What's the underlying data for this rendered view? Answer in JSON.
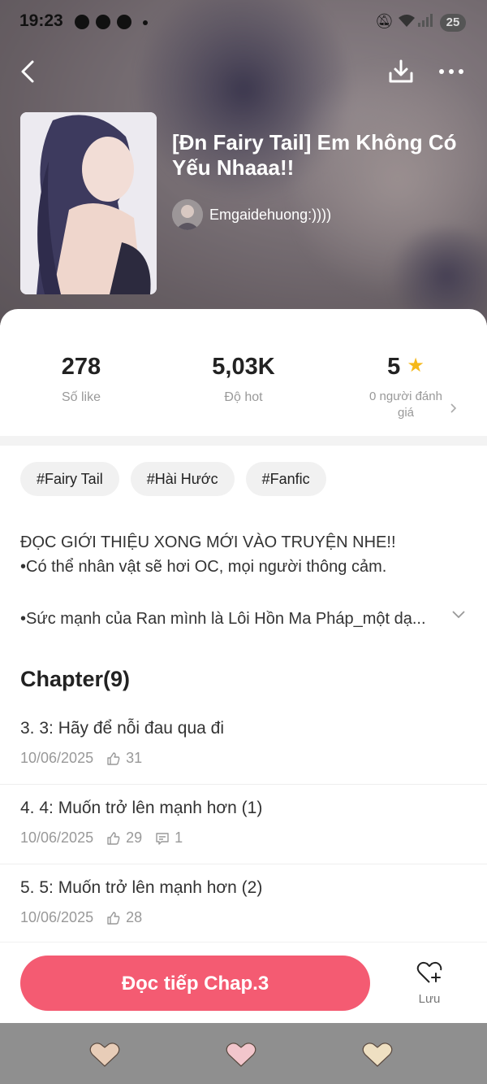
{
  "status_bar": {
    "time": "19:23",
    "battery": "25"
  },
  "colors": {
    "accent": "#f45b72",
    "star": "#f5b81a",
    "nav_bar": "#8f8f8f"
  },
  "story": {
    "title": "[Đn Fairy Tail] Em Không Có Yếu Nhaaa!!",
    "author": "Emgaidehuong:))))"
  },
  "stats": {
    "likes": {
      "value": "278",
      "label": "Số like"
    },
    "hot": {
      "value": "5,03K",
      "label": "Độ hot"
    },
    "rating": {
      "value": "5",
      "label_line1": "0 người đánh",
      "label_line2": "giá"
    }
  },
  "tags": [
    "#Fairy Tail",
    "#Hài Hước",
    "#Fanfic"
  ],
  "description": {
    "line1": "ĐỌC GIỚI THIỆU XONG MỚI VÀO TRUYỆN NHE!!",
    "line2": "•Có thể nhân vật sẽ hơi OC, mọi người thông cảm.",
    "line3": "•Sức mạnh của Ran mình là Lôi Hồn Ma Pháp_một dạ..."
  },
  "chapters": {
    "heading": "Chapter(9)",
    "items": [
      {
        "name": "3. 3: Hãy để nỗi đau qua đi",
        "date": "10/06/2025",
        "likes": "31",
        "comments": ""
      },
      {
        "name": "4. 4: Muốn trở lên mạnh hơn (1)",
        "date": "10/06/2025",
        "likes": "29",
        "comments": "1"
      },
      {
        "name": "5. 5: Muốn trở lên mạnh hơn (2)",
        "date": "10/06/2025",
        "likes": "28",
        "comments": ""
      }
    ]
  },
  "actions": {
    "read_label": "Đọc tiếp Chap.3",
    "save_label": "Lưu"
  },
  "icons": [
    "back-icon",
    "download-icon",
    "more-icon",
    "star-icon",
    "chevron-right-icon",
    "chevron-down-icon",
    "thumb-up-icon",
    "comment-icon",
    "heart-add-icon",
    "heart-icon"
  ]
}
